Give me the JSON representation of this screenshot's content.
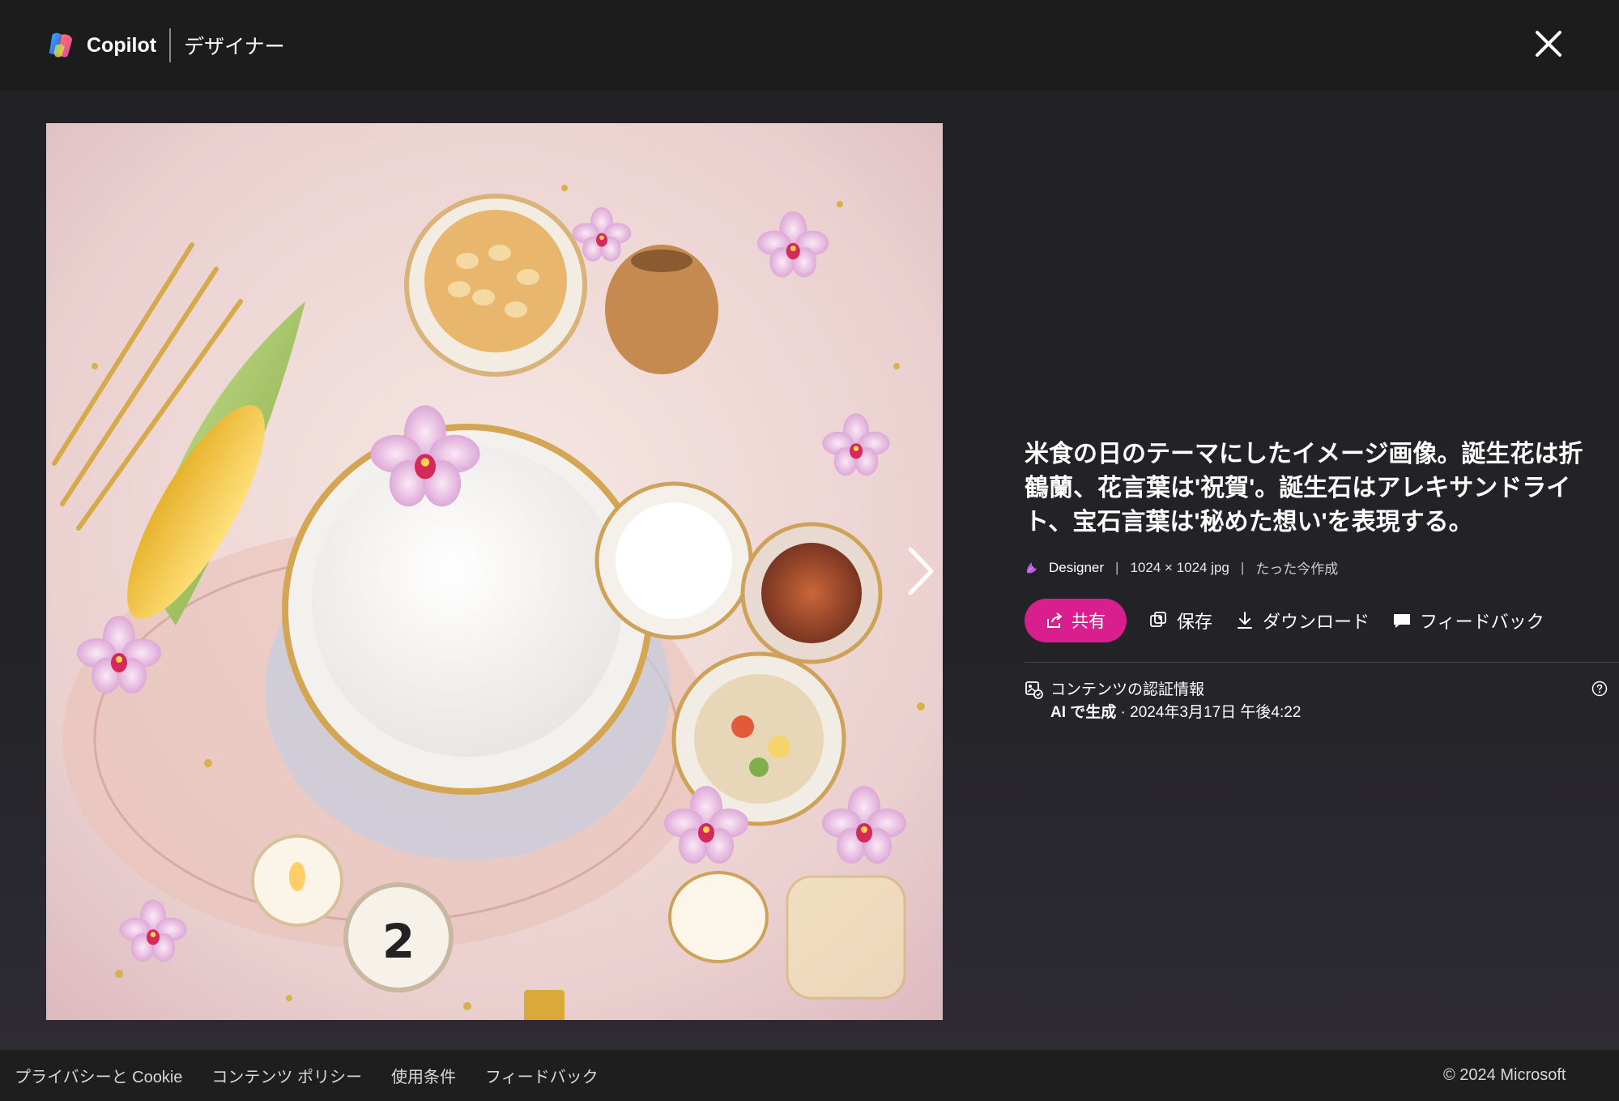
{
  "header": {
    "brand": "Copilot",
    "section": "デザイナー"
  },
  "image": {
    "alt": "米食の日のテーマにしたイメージ画像"
  },
  "details": {
    "title": "米食の日のテーマにしたイメージ画像。誕生花は折鶴蘭、花言葉は'祝賀'。誕生石はアレキサンドライト、宝石言葉は'秘めた想い'を表現する。",
    "app": "Designer",
    "size": "1024 × 1024 jpg",
    "created": "たった今作成",
    "separator": "|"
  },
  "actions": {
    "share": "共有",
    "save": "保存",
    "download": "ダウンロード",
    "feedback": "フィードバック"
  },
  "credentials": {
    "label": "コンテンツの認証情報",
    "ai": "AI で生成",
    "date": " · 2024年3月17日 午後4:22"
  },
  "footer": {
    "links": [
      "プライバシーと Cookie",
      "コンテンツ ポリシー",
      "使用条件",
      "フィードバック"
    ],
    "copyright": "© 2024 Microsoft"
  },
  "colors": {
    "accent": "#d91e8d",
    "background": "#232327"
  }
}
